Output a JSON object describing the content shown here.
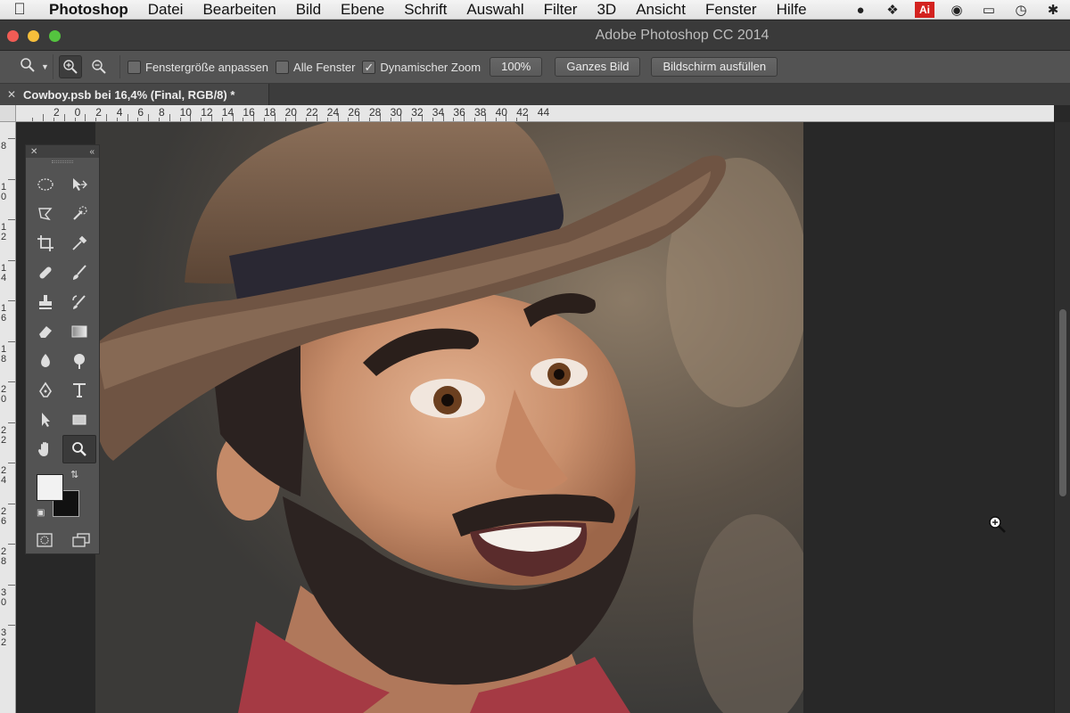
{
  "menubar": {
    "apple_icon": "apple-icon",
    "items": [
      "Photoshop",
      "Datei",
      "Bearbeiten",
      "Bild",
      "Ebene",
      "Schrift",
      "Auswahl",
      "Filter",
      "3D",
      "Ansicht",
      "Fenster",
      "Hilfe"
    ],
    "status_icons": [
      "evernote-icon",
      "dropbox-icon",
      "adobe-icon",
      "music-icon",
      "airplay-icon",
      "time-machine-icon",
      "bluetooth-icon"
    ]
  },
  "window": {
    "title": "Adobe Photoshop CC 2014"
  },
  "options": {
    "fit_window_label": "Fenstergröße anpassen",
    "fit_window_checked": false,
    "all_windows_label": "Alle Fenster",
    "all_windows_checked": false,
    "scrubby_zoom_label": "Dynamischer Zoom",
    "scrubby_zoom_checked": true,
    "btn_100": "100%",
    "btn_fit_screen": "Ganzes Bild",
    "btn_fill_screen": "Bildschirm ausfüllen"
  },
  "document": {
    "tab_title": "Cowboy.psb bei 16,4% (Final, RGB/8) *"
  },
  "ruler": {
    "h_labels": [
      "2",
      "0",
      "2",
      "4",
      "6",
      "8",
      "10",
      "12",
      "14",
      "16",
      "18",
      "20",
      "22",
      "24",
      "26",
      "28",
      "30",
      "32",
      "34",
      "36",
      "38",
      "40",
      "42",
      "44"
    ],
    "v_labels": [
      "8",
      "1\n0",
      "1\n2",
      "1\n4",
      "1\n6",
      "1\n8",
      "2\n0",
      "2\n2",
      "2\n4",
      "2\n6",
      "2\n8",
      "3\n0",
      "3\n2"
    ]
  },
  "colors": {
    "foreground": "#f2f2f2",
    "background": "#111111"
  }
}
